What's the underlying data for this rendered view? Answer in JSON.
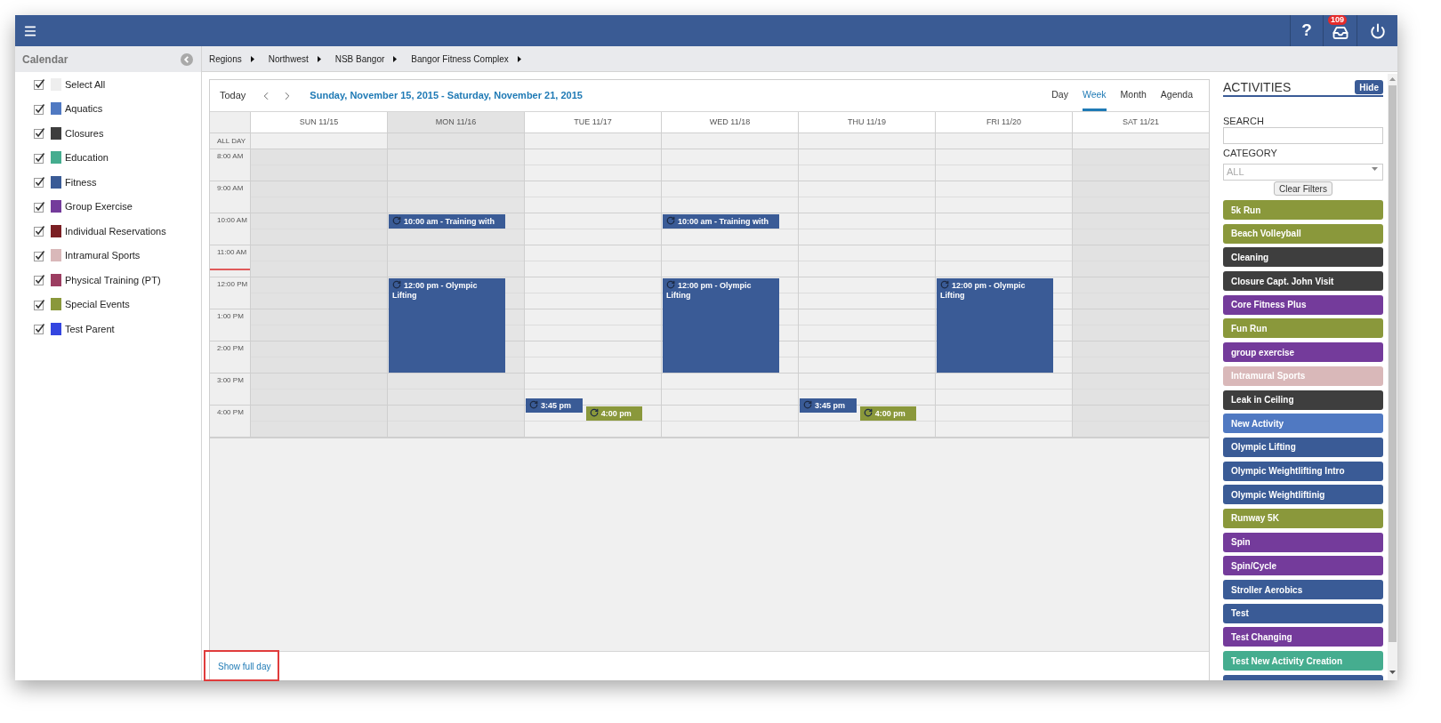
{
  "topbar": {
    "help_label": "?",
    "notification_count": "109"
  },
  "sidebar": {
    "title": "Calendar",
    "categories": [
      {
        "label": "Select All",
        "checked": true,
        "color": "#eeeeee"
      },
      {
        "label": "Aquatics",
        "checked": true,
        "color": "#5079c2"
      },
      {
        "label": "Closures",
        "checked": true,
        "color": "#3e3e3e"
      },
      {
        "label": "Education",
        "checked": true,
        "color": "#45ad8f"
      },
      {
        "label": "Fitness",
        "checked": true,
        "color": "#3a5b96"
      },
      {
        "label": "Group Exercise",
        "checked": true,
        "color": "#743b9b"
      },
      {
        "label": "Individual Reservations",
        "checked": true,
        "color": "#7b1f24"
      },
      {
        "label": "Intramural Sports",
        "checked": true,
        "color": "#d9b8b9"
      },
      {
        "label": "Physical Training (PT)",
        "checked": true,
        "color": "#9c3d61"
      },
      {
        "label": "Special Events",
        "checked": true,
        "color": "#8a983b"
      },
      {
        "label": "Test Parent",
        "checked": true,
        "color": "#3446e0"
      }
    ]
  },
  "breadcrumb": [
    "Regions",
    "Northwest",
    "NSB Bangor",
    "Bangor Fitness Complex"
  ],
  "calendar": {
    "today_button": "Today",
    "range_title": "Sunday, November 15, 2015 - Saturday, November 21, 2015",
    "views": [
      {
        "label": "Day",
        "selected": false
      },
      {
        "label": "Week",
        "selected": true
      },
      {
        "label": "Month",
        "selected": false
      },
      {
        "label": "Agenda",
        "selected": false
      }
    ],
    "all_day_label": "ALL DAY",
    "hours": [
      {
        "label": "8:00 AM",
        "current": false
      },
      {
        "label": "9:00 AM",
        "current": false
      },
      {
        "label": "10:00 AM",
        "current": false
      },
      {
        "label": "11:00 AM",
        "current": true
      },
      {
        "label": "12:00 PM",
        "current": false
      },
      {
        "label": "1:00 PM",
        "current": false
      },
      {
        "label": "2:00 PM",
        "current": false
      },
      {
        "label": "3:00 PM",
        "current": false
      },
      {
        "label": "4:00 PM",
        "current": false
      }
    ],
    "days": [
      {
        "label": "SUN 11/15",
        "today": false,
        "nonwork": true
      },
      {
        "label": "MON 11/16",
        "today": true,
        "nonwork": false,
        "events": [
          {
            "text": "10:00 am - Training with",
            "kind": "short",
            "color": "#3a5b96"
          },
          {
            "text": "12:00 pm - Olympic Lifting",
            "kind": "long",
            "color": "#3a5b96"
          }
        ]
      },
      {
        "label": "TUE 11/17",
        "today": false,
        "nonwork": false,
        "events": [
          {
            "text": "3:45 pm",
            "kind": "short",
            "color": "#3a5b96"
          },
          {
            "text": "4:00 pm",
            "kind": "short",
            "color": "#8a983b"
          }
        ]
      },
      {
        "label": "WED 11/18",
        "today": false,
        "nonwork": false,
        "events": [
          {
            "text": "10:00 am - Training with",
            "kind": "short",
            "color": "#3a5b96"
          },
          {
            "text": "12:00 pm - Olympic Lifting",
            "kind": "long",
            "color": "#3a5b96"
          }
        ]
      },
      {
        "label": "THU 11/19",
        "today": false,
        "nonwork": false,
        "events": [
          {
            "text": "3:45 pm",
            "kind": "short",
            "color": "#3a5b96"
          },
          {
            "text": "4:00 pm",
            "kind": "short",
            "color": "#8a983b"
          }
        ]
      },
      {
        "label": "FRI 11/20",
        "today": false,
        "nonwork": false,
        "events": [
          {
            "text": "12:00 pm - Olympic Lifting",
            "kind": "long",
            "color": "#3a5b96"
          }
        ]
      },
      {
        "label": "SAT 11/21",
        "today": false,
        "nonwork": true
      }
    ],
    "footer": {
      "link": "Show full day",
      "highlighted": true
    }
  },
  "activities": {
    "title": "ACTIVITIES",
    "hide_button": "Hide",
    "search_label": "SEARCH",
    "category_label": "CATEGORY",
    "category_placeholder": "ALL",
    "clear_button": "Clear Filters",
    "items": [
      {
        "label": "5k Run",
        "color": "#8a983b"
      },
      {
        "label": "Beach Volleyball",
        "color": "#8a983b"
      },
      {
        "label": "Cleaning",
        "color": "#3e3e3e"
      },
      {
        "label": "Closure Capt. John Visit",
        "color": "#3e3e3e"
      },
      {
        "label": "Core Fitness Plus",
        "color": "#743b9b"
      },
      {
        "label": "Fun Run",
        "color": "#8a983b"
      },
      {
        "label": "group exercise",
        "color": "#743b9b"
      },
      {
        "label": "Intramural Sports",
        "color": "#d9b8b9"
      },
      {
        "label": "Leak in Ceiling",
        "color": "#3e3e3e"
      },
      {
        "label": "New Activity",
        "color": "#5079c2"
      },
      {
        "label": "Olympic Lifting",
        "color": "#3a5b96"
      },
      {
        "label": "Olympic Weightlifting Intro",
        "color": "#3a5b96"
      },
      {
        "label": "Olympic Weightliftinig",
        "color": "#3a5b96"
      },
      {
        "label": "Runway 5K",
        "color": "#8a983b"
      },
      {
        "label": "Spin",
        "color": "#743b9b"
      },
      {
        "label": "Spin/Cycle",
        "color": "#743b9b"
      },
      {
        "label": "Stroller Aerobics",
        "color": "#3a5b96"
      },
      {
        "label": "Test",
        "color": "#3a5b96"
      },
      {
        "label": "Test Changing",
        "color": "#743b9b"
      },
      {
        "label": "Test New Activity Creation",
        "color": "#45ad8f"
      },
      {
        "color": "#3a5b96"
      }
    ]
  }
}
